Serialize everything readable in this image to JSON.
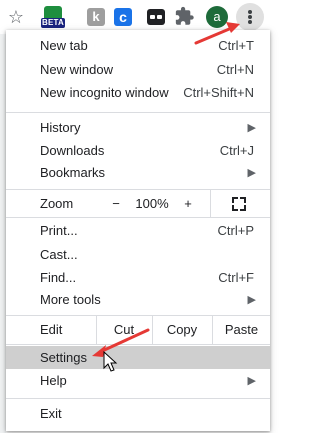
{
  "toolbar": {
    "star_icon": "☆",
    "beta_badge": "BETA",
    "ext_k": "k",
    "ext_c": "c",
    "avatar_letter": "a"
  },
  "menu": {
    "new_tab": {
      "label": "New tab",
      "shortcut": "Ctrl+T"
    },
    "new_window": {
      "label": "New window",
      "shortcut": "Ctrl+N"
    },
    "new_incognito": {
      "label": "New incognito window",
      "shortcut": "Ctrl+Shift+N"
    },
    "history": {
      "label": "History"
    },
    "downloads": {
      "label": "Downloads",
      "shortcut": "Ctrl+J"
    },
    "bookmarks": {
      "label": "Bookmarks"
    },
    "zoom": {
      "label": "Zoom",
      "minus": "−",
      "value": "100%",
      "plus": "+"
    },
    "print": {
      "label": "Print...",
      "shortcut": "Ctrl+P"
    },
    "cast": {
      "label": "Cast..."
    },
    "find": {
      "label": "Find...",
      "shortcut": "Ctrl+F"
    },
    "more_tools": {
      "label": "More tools"
    },
    "edit": {
      "label": "Edit",
      "cut": "Cut",
      "copy": "Copy",
      "paste": "Paste"
    },
    "settings": {
      "label": "Settings"
    },
    "help": {
      "label": "Help"
    },
    "exit": {
      "label": "Exit"
    }
  },
  "colors": {
    "annotation_arrow": "#e53935",
    "hover_bg": "#cfcfcf",
    "avatar_bg": "#1e6b3a"
  }
}
